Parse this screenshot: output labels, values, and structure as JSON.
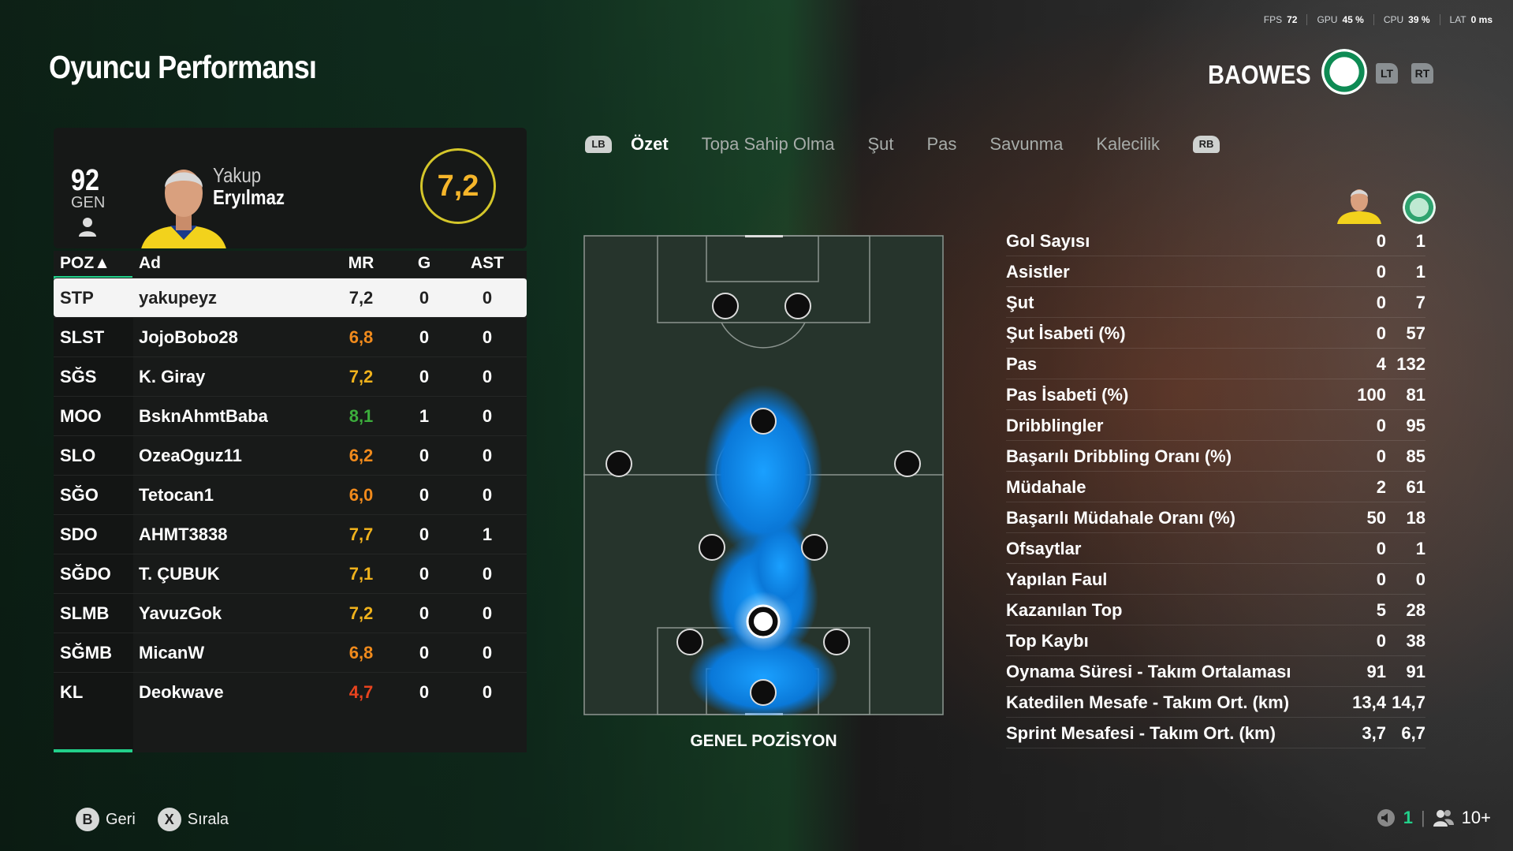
{
  "hud": {
    "fps_label": "FPS",
    "fps": "72",
    "gpu_label": "GPU",
    "gpu": "45 %",
    "cpu_label": "CPU",
    "cpu": "39 %",
    "lat_label": "LAT",
    "lat": "0 ms"
  },
  "page_title": "Oyuncu Performansı",
  "club": {
    "name": "BAOWES",
    "lt": "LT",
    "rt": "RT"
  },
  "player": {
    "ovr": "92",
    "ovr_label": "GEN",
    "first_name": "Yakup",
    "last_name": "Eryılmaz",
    "rating": "7,2"
  },
  "table": {
    "headers": {
      "pos": "POZ▲",
      "name": "Ad",
      "mr": "MR",
      "g": "G",
      "ast": "AST"
    },
    "rows": [
      {
        "pos": "STP",
        "name": "yakupeyz",
        "mr": "7,2",
        "g": "0",
        "ast": "0",
        "color": "#222222"
      },
      {
        "pos": "SLST",
        "name": "JojoBobo28",
        "mr": "6,8",
        "g": "0",
        "ast": "0",
        "color": "#f08a1c"
      },
      {
        "pos": "SĞS",
        "name": "K. Giray",
        "mr": "7,2",
        "g": "0",
        "ast": "0",
        "color": "#f0b21c"
      },
      {
        "pos": "MOO",
        "name": "BsknAhmtBaba",
        "mr": "8,1",
        "g": "1",
        "ast": "0",
        "color": "#3cae3c"
      },
      {
        "pos": "SLO",
        "name": "OzeaOguz11",
        "mr": "6,2",
        "g": "0",
        "ast": "0",
        "color": "#f08a1c"
      },
      {
        "pos": "SĞO",
        "name": "Tetocan1",
        "mr": "6,0",
        "g": "0",
        "ast": "0",
        "color": "#f08a1c"
      },
      {
        "pos": "SDO",
        "name": "AHMT3838",
        "mr": "7,7",
        "g": "0",
        "ast": "1",
        "color": "#f0b21c"
      },
      {
        "pos": "SĞDO",
        "name": "T. ÇUBUK",
        "mr": "7,1",
        "g": "0",
        "ast": "0",
        "color": "#f0b21c"
      },
      {
        "pos": "SLMB",
        "name": "YavuzGok",
        "mr": "7,2",
        "g": "0",
        "ast": "0",
        "color": "#f0b21c"
      },
      {
        "pos": "SĞMB",
        "name": "MicanW",
        "mr": "6,8",
        "g": "0",
        "ast": "0",
        "color": "#f08a1c"
      },
      {
        "pos": "KL",
        "name": "Deokwave",
        "mr": "4,7",
        "g": "0",
        "ast": "0",
        "color": "#e8431e"
      }
    ]
  },
  "tabs": {
    "lb": "LB",
    "rb": "RB",
    "items": [
      "Özet",
      "Topa Sahip Olma",
      "Şut",
      "Pas",
      "Savunma",
      "Kalecilik"
    ]
  },
  "pitch_caption": "GENEL POZİSYON",
  "stats": [
    {
      "label": "Gol Sayısı",
      "player": "0",
      "team": "1"
    },
    {
      "label": "Asistler",
      "player": "0",
      "team": "1"
    },
    {
      "label": "Şut",
      "player": "0",
      "team": "7"
    },
    {
      "label": "Şut İsabeti (%)",
      "player": "0",
      "team": "57"
    },
    {
      "label": "Pas",
      "player": "4",
      "team": "132"
    },
    {
      "label": "Pas İsabeti (%)",
      "player": "100",
      "team": "81"
    },
    {
      "label": "Dribblingler",
      "player": "0",
      "team": "95"
    },
    {
      "label": "Başarılı Dribbling Oranı (%)",
      "player": "0",
      "team": "85"
    },
    {
      "label": "Müdahale",
      "player": "2",
      "team": "61"
    },
    {
      "label": "Başarılı Müdahale Oranı (%)",
      "player": "50",
      "team": "18"
    },
    {
      "label": "Ofsaytlar",
      "player": "0",
      "team": "1"
    },
    {
      "label": "Yapılan Faul",
      "player": "0",
      "team": "0"
    },
    {
      "label": "Kazanılan Top",
      "player": "5",
      "team": "28"
    },
    {
      "label": "Top Kaybı",
      "player": "0",
      "team": "38"
    },
    {
      "label": "Oynama Süresi - Takım Ortalaması",
      "player": "91",
      "team": "91"
    },
    {
      "label": "Katedilen Mesafe - Takım Ort. (km)",
      "player": "13,4",
      "team": "14,7"
    },
    {
      "label": "Sprint Mesafesi - Takım Ort. (km)",
      "player": "3,7",
      "team": "6,7"
    }
  ],
  "footer": {
    "b_btn": "B",
    "back": "Geri",
    "x_btn": "X",
    "sort": "Sırala"
  },
  "network": {
    "count": "1",
    "players": "10+"
  }
}
